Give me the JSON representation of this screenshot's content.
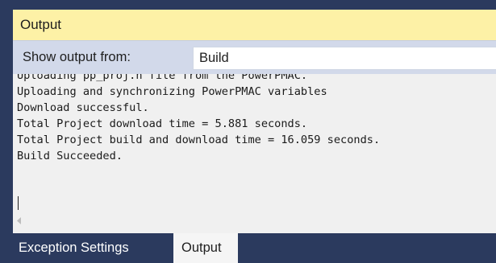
{
  "panel": {
    "title": "Output"
  },
  "toolbar": {
    "show_output_label": "Show output from:",
    "source_value": "Build"
  },
  "console": {
    "lines": [
      "Uploading pp_proj.h file from the PowerPMAC.",
      "Uploading and synchronizing PowerPMAC variables",
      "Download successful.",
      "Total Project download time = 5.881 seconds.",
      "Total Project build and download time = 16.059 seconds.",
      "Build Succeeded."
    ]
  },
  "tabs": [
    {
      "label": "Exception Settings",
      "active": false
    },
    {
      "label": "Output",
      "active": true
    }
  ],
  "colors": {
    "title_background": "#fdf1a6",
    "toolbar_background": "#d2d9ea",
    "frame_background": "#2b3a5e",
    "console_background": "#f0f0f0"
  }
}
